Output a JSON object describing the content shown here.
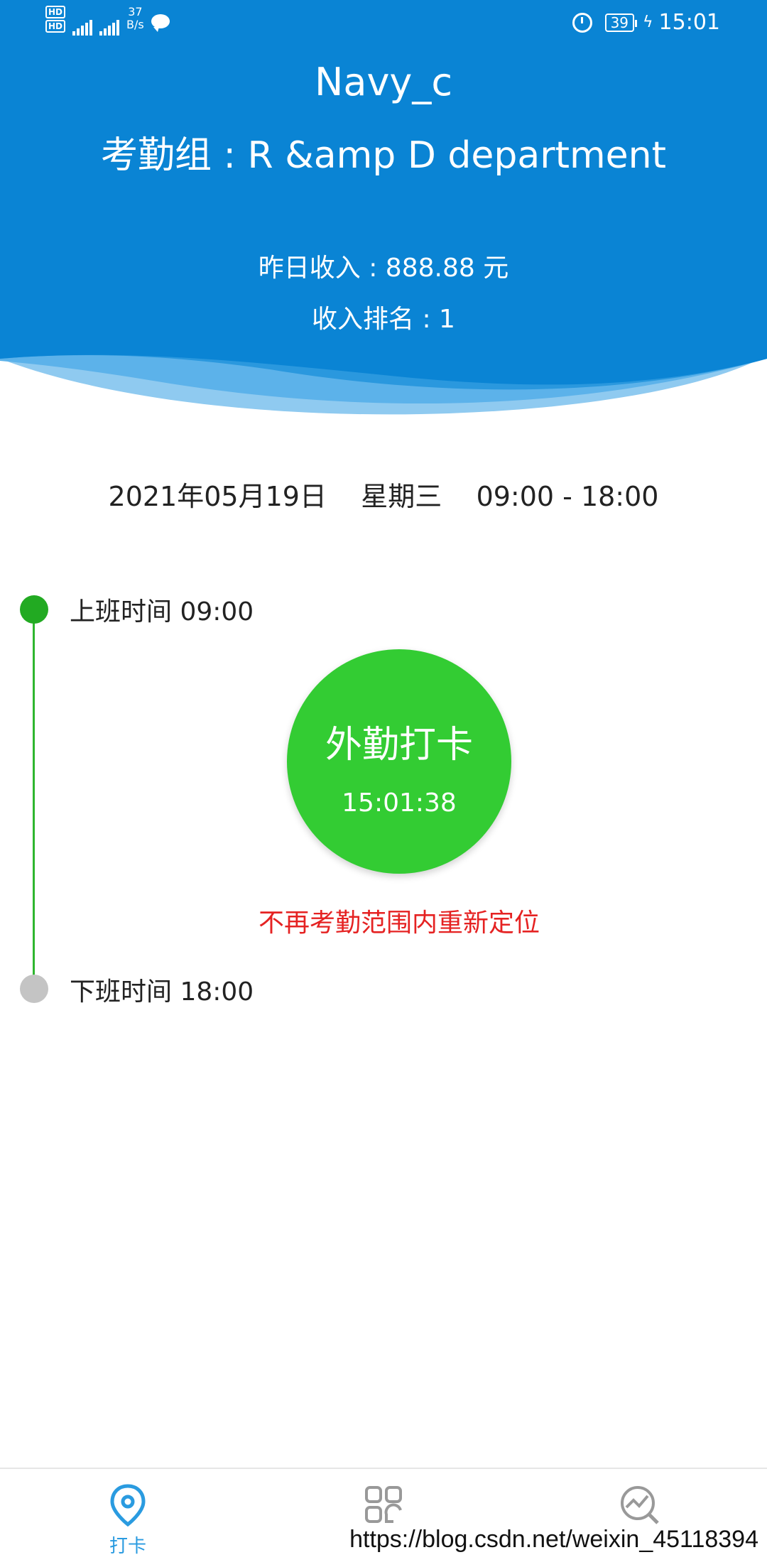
{
  "status_bar": {
    "hd_top": "HD",
    "hd_bottom": "HD",
    "net_speed_value": "37",
    "net_speed_unit": "B/s",
    "battery": "39",
    "time": "15:01"
  },
  "header": {
    "user_name": "Navy_c",
    "attendance_group": "考勤组 : R &amp D department",
    "yesterday_income": "昨日收入 : 888.88 元",
    "income_rank": "收入排名 : 1"
  },
  "schedule": {
    "date_line": "2021年05月19日    星期三    09:00 - 18:00"
  },
  "timeline": {
    "start_label": "上班时间  09:00",
    "end_label": "下班时间  18:00"
  },
  "punch": {
    "title": "外勤打卡",
    "time": "15:01:38",
    "warning": "不再考勤范围内重新定位"
  },
  "nav": {
    "items": [
      {
        "label": "打卡",
        "icon": "location-pin-icon"
      },
      {
        "label": "",
        "icon": "grid-icon"
      },
      {
        "label": "",
        "icon": "stats-search-icon"
      }
    ]
  },
  "watermark": "https://blog.csdn.net/weixin_45118394",
  "colors": {
    "header_blue": "#0a84d4",
    "punch_green": "#33cc33",
    "timeline_green": "#22aa22",
    "warning_red": "#e52222",
    "nav_active": "#2a9be0"
  }
}
